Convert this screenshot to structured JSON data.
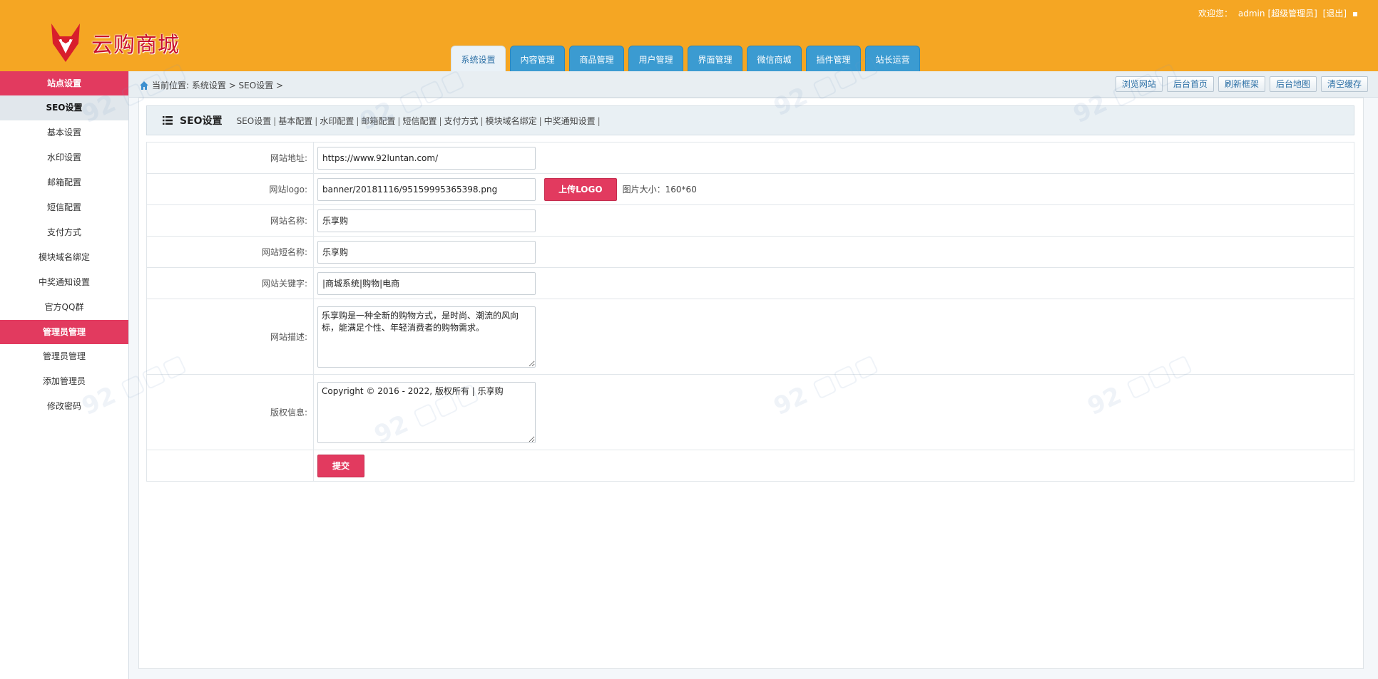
{
  "header": {
    "brand": "云购商城",
    "welcome": "欢迎您：",
    "user": "admin",
    "role": "[超级管理员]",
    "logout": "[退出]",
    "tabs": [
      {
        "label": "系统设置",
        "active": true
      },
      {
        "label": "内容管理",
        "active": false
      },
      {
        "label": "商品管理",
        "active": false
      },
      {
        "label": "用户管理",
        "active": false
      },
      {
        "label": "界面管理",
        "active": false
      },
      {
        "label": "微信商城",
        "active": false
      },
      {
        "label": "插件管理",
        "active": false
      },
      {
        "label": "站长运营",
        "active": false
      }
    ]
  },
  "sidebar": {
    "group1": "站点设置",
    "items1": [
      "SEO设置",
      "基本设置",
      "水印设置",
      "邮箱配置",
      "短信配置",
      "支付方式",
      "模块域名绑定",
      "中奖通知设置",
      "官方QQ群"
    ],
    "group2": "管理员管理",
    "items2": [
      "管理员管理",
      "添加管理员",
      "修改密码"
    ]
  },
  "breadcrumb": {
    "prefix": "当前位置:",
    "path": "系统设置 > SEO设置 >"
  },
  "quick_buttons": [
    "浏览网站",
    "后台首页",
    "刷新框架",
    "后台地图",
    "清空缓存"
  ],
  "panel": {
    "title": "SEO设置",
    "sub_links": [
      "SEO设置",
      "基本配置",
      "水印配置",
      "邮箱配置",
      "短信配置",
      "支付方式",
      "模块域名绑定",
      "中奖通知设置"
    ],
    "sep": "|"
  },
  "form": {
    "url_label": "网站地址:",
    "url_value": "https://www.92luntan.com/",
    "logo_label": "网站logo:",
    "logo_value": "banner/20181116/95159995365398.png",
    "upload_label": "上传LOGO",
    "size_hint": "图片大小：160*60",
    "name_label": "网站名称:",
    "name_value": "乐享购",
    "short_label": "网站短名称:",
    "short_value": "乐享购",
    "keywords_label": "网站关键字:",
    "keywords_value": "|商城系统|购物|电商",
    "desc_label": "网站描述:",
    "desc_value": "乐享购是一种全新的购物方式，是时尚、潮流的风向标，能满足个性、年轻消费者的购物需求。",
    "copyright_label": "版权信息:",
    "copyright_value": "Copyright © 2016 - 2022, 版权所有 | 乐享购",
    "submit_label": "提交"
  },
  "colors": {
    "header_bg": "#f5a623",
    "accent_red": "#e23a5f",
    "tab_blue": "#3b9bd1"
  }
}
